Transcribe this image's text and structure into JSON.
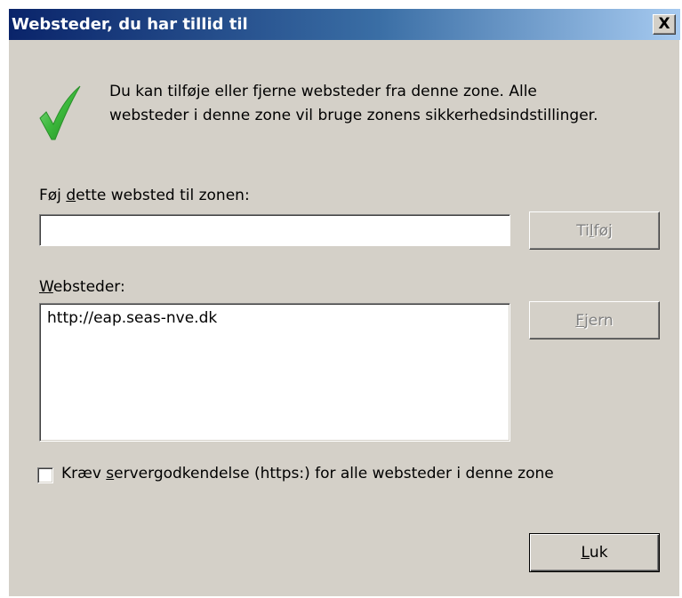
{
  "window": {
    "title": "Websteder, du har tillid til",
    "close_label": "X"
  },
  "info": {
    "icon": "check-icon",
    "line1": "Du kan tilføje eller fjerne websteder fra denne zone. Alle",
    "line2": "websteder i denne zone vil bruge zonens sikkerhedsindstillinger."
  },
  "add_site": {
    "label_pre": "Føj ",
    "label_accel": "d",
    "label_post": "ette websted til zonen:",
    "input_value": "",
    "button_pre": "Ti",
    "button_accel": "l",
    "button_post": "føj",
    "button_enabled": false
  },
  "sites": {
    "label_pre": "",
    "label_accel": "W",
    "label_post": "ebsteder:",
    "items": [
      "http://eap.seas-nve.dk"
    ],
    "remove_pre": "",
    "remove_accel": "F",
    "remove_post": "jern",
    "remove_enabled": false
  },
  "require_https": {
    "checked": false,
    "label_pre": "Kræv ",
    "label_accel": "s",
    "label_post": "ervergodkendelse (https:) for alle websteder i denne zone"
  },
  "close_button": {
    "pre": "",
    "accel": "L",
    "post": "uk"
  },
  "colors": {
    "face": "#d4d0c8",
    "title_start": "#0a246a",
    "title_end": "#a6caf0",
    "check_green": "#3cb83c",
    "disabled_text": "#808080"
  }
}
